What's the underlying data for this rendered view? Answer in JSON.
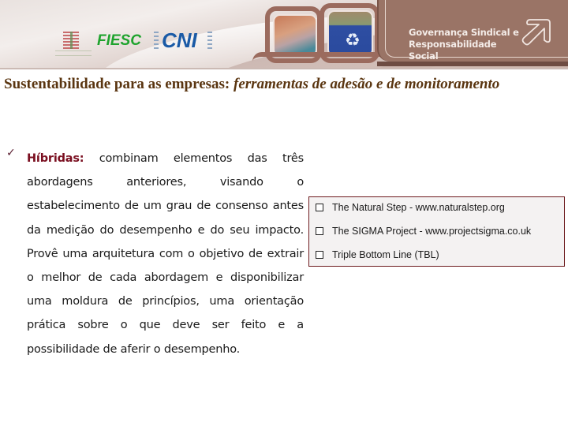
{
  "banner": {
    "logos": {
      "emblem": "federation-emblem",
      "fiesc": "FIESC",
      "cni": "CNI"
    },
    "panel_title_line1": "Governança Sindical e",
    "panel_title_line2": "Responsabilidade Social",
    "arrow_icon": "arrow-up-right-icon",
    "recycle_icon": "♻"
  },
  "title": {
    "normal": "Sustentabilidade para as empresas: ",
    "italic": "ferramentas de adesão e de monitoramento"
  },
  "bullet": {
    "marker": "✓",
    "lead": "Híbridas:",
    "text": " combinam elementos das três abordagens anteriores, visando o estabelecimento de um grau de consenso antes da medição do desempenho e do seu impacto. Provê uma arquitetura com o objetivo de extrair o melhor de cada abordagem e disponibilizar uma moldura de princípios, uma orientação prática sobre o que deve ser feito e a possibilidade de aferir o desempenho."
  },
  "references": {
    "items": [
      {
        "label": "The Natural Step - www.naturalstep.org"
      },
      {
        "label": "The SIGMA Project - www.projectsigma.co.uk"
      },
      {
        "label": "Triple Bottom Line (TBL)"
      }
    ]
  },
  "colors": {
    "title": "#5a3510",
    "lead": "#7a0f20",
    "box_border": "#6d1a1e",
    "box_bg": "#f4f2f2",
    "panel": "#9a7466",
    "fiesc_green": "#1fa32e",
    "cni_blue": "#1a5aa6"
  }
}
